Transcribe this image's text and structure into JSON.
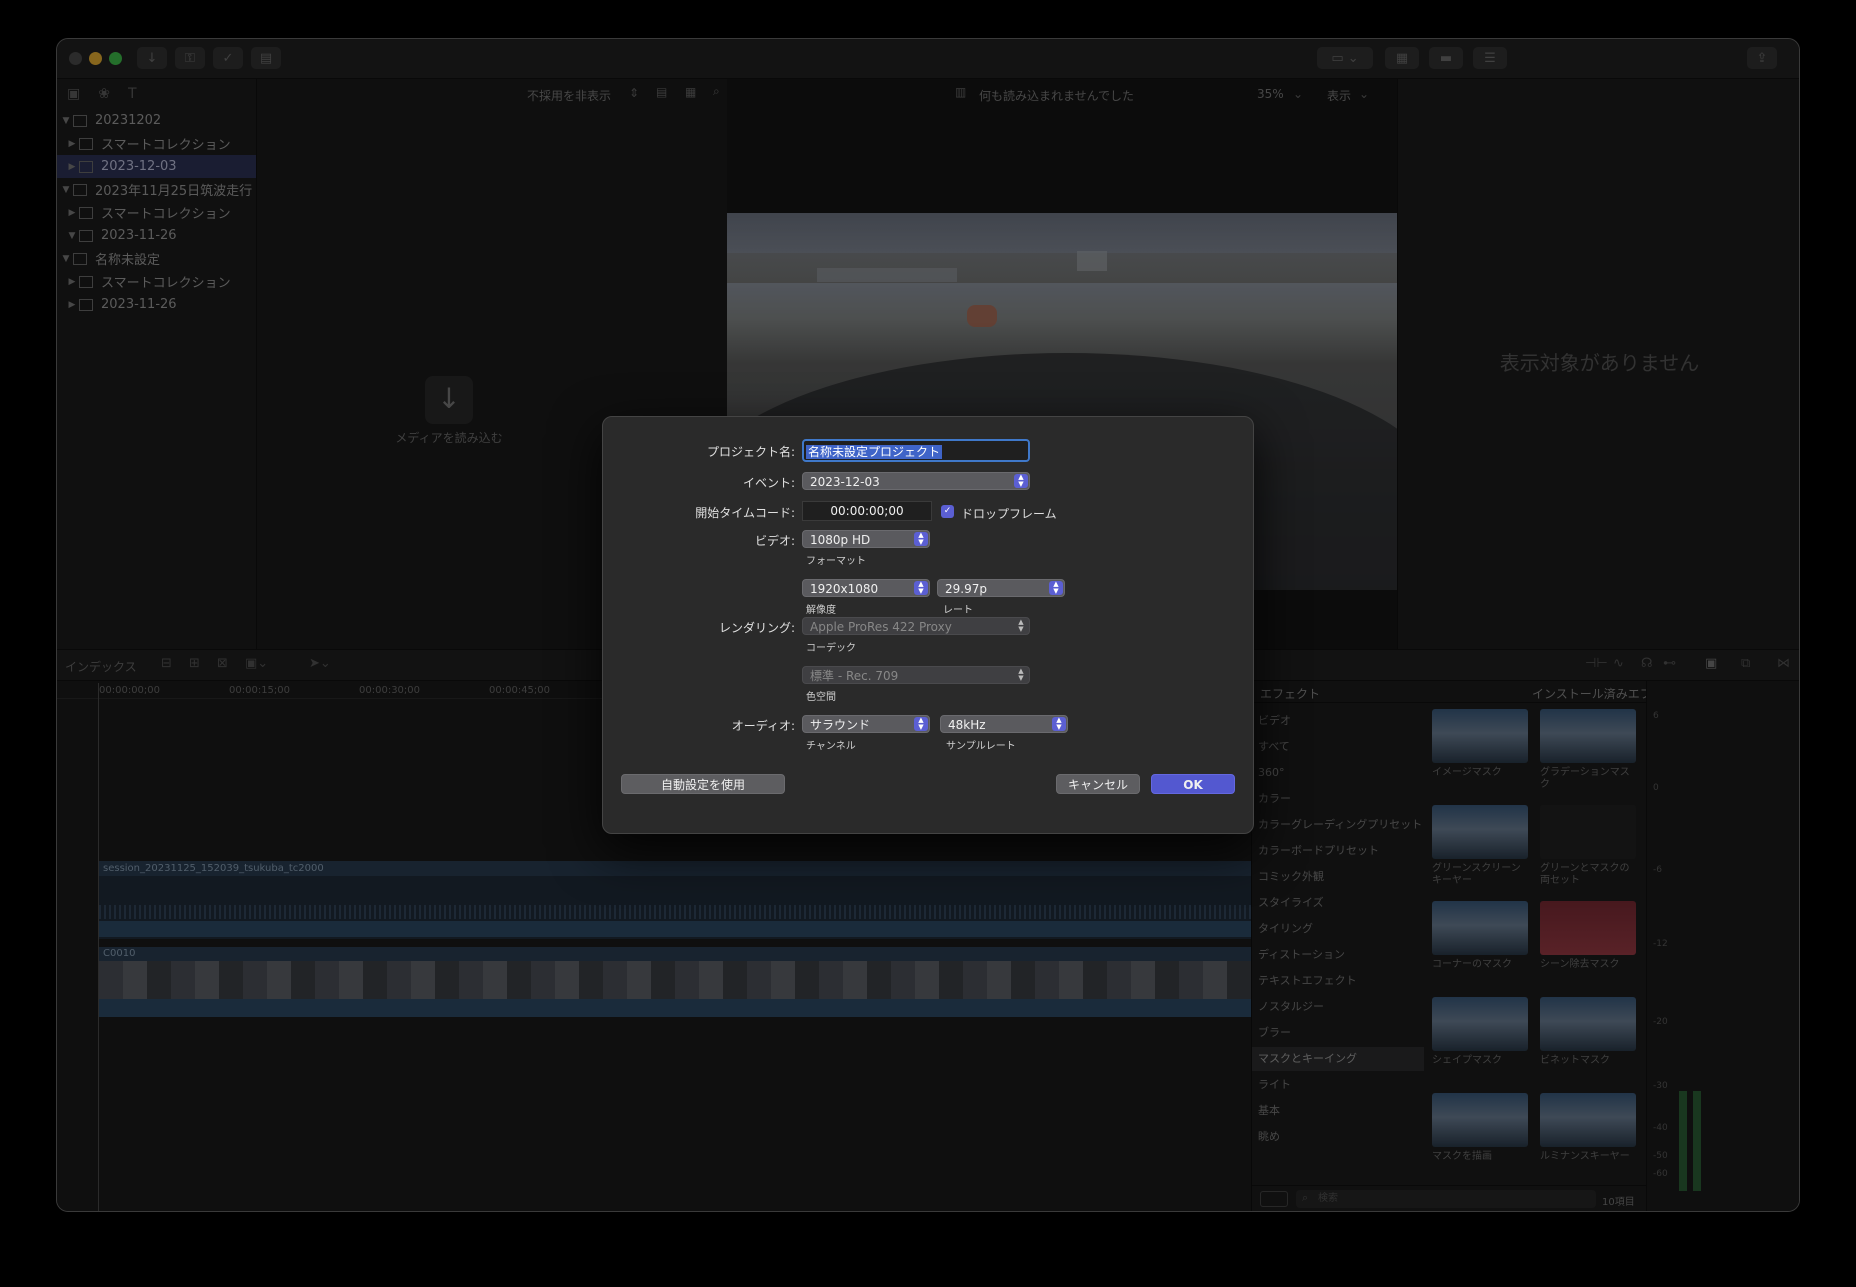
{
  "library": {
    "items": [
      {
        "label": "20231202",
        "level": 0,
        "expanded": true,
        "icon": "library-icon"
      },
      {
        "label": "スマートコレクション",
        "level": 1,
        "expanded": false,
        "icon": "folder-icon"
      },
      {
        "label": "2023-12-03",
        "level": 1,
        "expanded": false,
        "icon": "event-icon",
        "selected": true
      },
      {
        "label": "2023年11月25日筑波走行",
        "level": 0,
        "expanded": true,
        "icon": "library-icon"
      },
      {
        "label": "スマートコレクション",
        "level": 1,
        "expanded": false,
        "icon": "folder-icon"
      },
      {
        "label": "2023-11-26",
        "level": 1,
        "expanded": true,
        "icon": "event-icon"
      },
      {
        "label": "名称未設定",
        "level": 0,
        "expanded": true,
        "icon": "library-icon"
      },
      {
        "label": "スマートコレクション",
        "level": 1,
        "expanded": false,
        "icon": "folder-icon"
      },
      {
        "label": "2023-11-26",
        "level": 1,
        "expanded": false,
        "icon": "event-icon"
      }
    ]
  },
  "browser": {
    "filter_label": "不採用を非表示",
    "import_label": "メディアを読み込む"
  },
  "viewer": {
    "status": "何も読み込まれませんでした",
    "zoom": "35%",
    "view_menu": "表示"
  },
  "inspector": {
    "empty_text": "表示対象がありません"
  },
  "timeline": {
    "index_label": "インデックス",
    "ruler": [
      "00:00:00;00",
      "00:00:15;00",
      "00:00:30;00",
      "00:00:45;00"
    ],
    "clip1": "session_20231125_152039_tsukuba_tc2000",
    "clip2": "C0010"
  },
  "effects": {
    "title": "エフェクト",
    "installed": "インストール済みエフェクト",
    "categories": [
      "ビデオ",
      "すべて",
      "360°",
      "カラー",
      "カラーグレーディングプリセット",
      "カラーボードプリセット",
      "コミック外観",
      "スタイライズ",
      "タイリング",
      "ディストーション",
      "テキストエフェクト",
      "ノスタルジー",
      "ブラー",
      "マスクとキーイング",
      "ライト",
      "基本",
      "眺め"
    ],
    "selected_category": "マスクとキーイング",
    "items": [
      "イメージマスク",
      "グラデーションマスク",
      "グリーンスクリーンキーヤー",
      "グリーンとマスクの両セット",
      "コーナーのマスク",
      "シーン除去マスク",
      "シェイプマスク",
      "ビネットマスク",
      "マスクを描画",
      "ルミナンスキーヤー"
    ],
    "search_placeholder": "検索",
    "count": "10項目",
    "meter_ticks": [
      "6",
      "0",
      "-6",
      "-12",
      "-20",
      "-30",
      "-40",
      "-50",
      "-60"
    ]
  },
  "dialog": {
    "project_name_label": "プロジェクト名:",
    "project_name_value": "名称未設定プロジェクト",
    "event_label": "イベント:",
    "event_value": "2023-12-03",
    "timecode_label": "開始タイムコード:",
    "timecode_value": "00:00:00;00",
    "dropframe_label": "ドロップフレーム",
    "dropframe_checked": true,
    "video_label": "ビデオ:",
    "format_value": "1080p HD",
    "format_caption": "フォーマット",
    "resolution_value": "1920x1080",
    "resolution_caption": "解像度",
    "rate_value": "29.97p",
    "rate_caption": "レート",
    "rendering_label": "レンダリング:",
    "codec_value": "Apple ProRes 422 Proxy",
    "codec_caption": "コーデック",
    "colorspace_value": "標準 - Rec. 709",
    "colorspace_caption": "色空間",
    "audio_label": "オーディオ:",
    "channels_value": "サラウンド",
    "channels_caption": "チャンネル",
    "samplerate_value": "48kHz",
    "samplerate_caption": "サンプルレート",
    "auto_button": "自動設定を使用",
    "cancel_button": "キャンセル",
    "ok_button": "OK"
  },
  "colors": {
    "accent": "#5b5fd3",
    "selection": "#2e3256",
    "ok_button": "#5358d0"
  }
}
